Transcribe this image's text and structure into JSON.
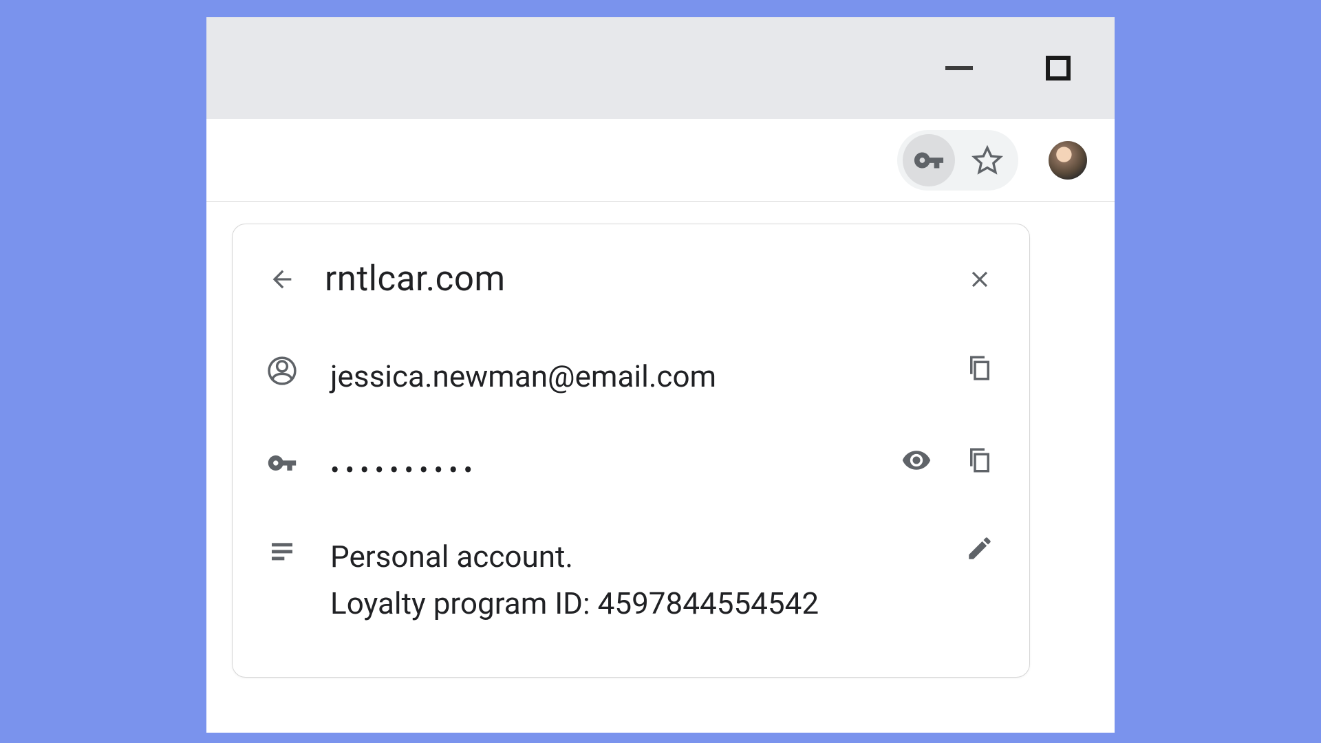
{
  "site": "rntlcar.com",
  "username": "jessica.newman@email.com",
  "password_mask": "••••••••••",
  "note_line1": "Personal account.",
  "note_line2": "Loyalty program ID: 4597844554542"
}
